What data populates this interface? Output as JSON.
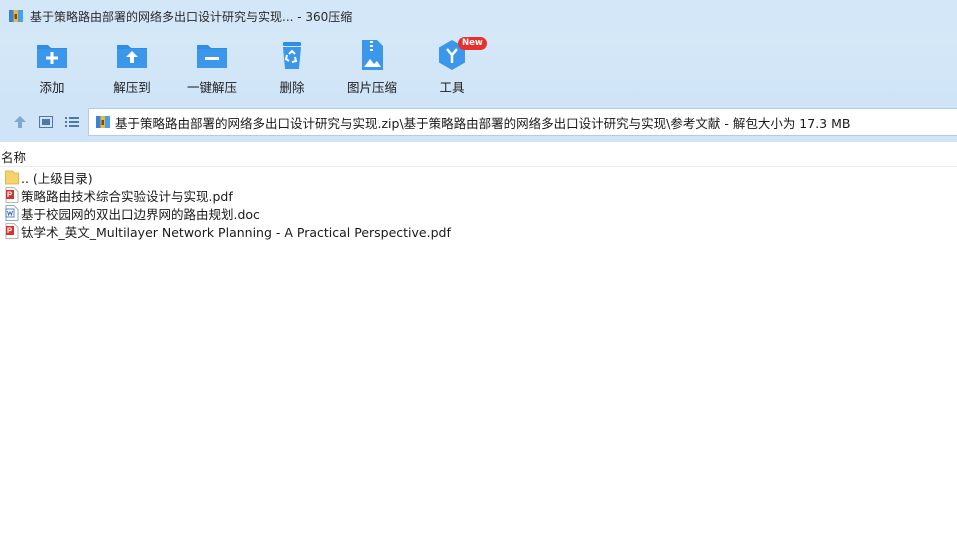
{
  "window": {
    "title": "基于策略路由部署的网络多出口设计研究与实现... - 360压缩"
  },
  "toolbar": {
    "items": [
      {
        "label": "添加",
        "icon": "add-folder-icon"
      },
      {
        "label": "解压到",
        "icon": "extract-to-folder-icon"
      },
      {
        "label": "一键解压",
        "icon": "one-click-extract-icon"
      },
      {
        "label": "删除",
        "icon": "recycle-bin-icon"
      },
      {
        "label": "图片压缩",
        "icon": "image-compress-icon"
      },
      {
        "label": "工具",
        "icon": "tools-cube-icon",
        "badge": "New"
      }
    ]
  },
  "navigation": {
    "address": "基于策略路由部署的网络多出口设计研究与实现.zip\\基于策略路由部署的网络多出口设计研究与实现\\参考文献 - 解包大小为 17.3 MB"
  },
  "list": {
    "column_name": "名称",
    "rows": [
      {
        "name": ".. (上级目录)",
        "icon": "parent-folder-icon"
      },
      {
        "name": "策略路由技术综合实验设计与实现.pdf",
        "icon": "pdf-file-icon"
      },
      {
        "name": "基于校园网的双出口边界网的路由规划.doc",
        "icon": "doc-file-icon"
      },
      {
        "name": "钛学术_英文_Multilayer Network Planning - A Practical Perspective.pdf",
        "icon": "pdf-file-icon"
      }
    ]
  },
  "colors": {
    "toolbar_bg": "#cfe4f7",
    "icon_blue": "#2f8de4",
    "badge_red": "#e8302f"
  }
}
